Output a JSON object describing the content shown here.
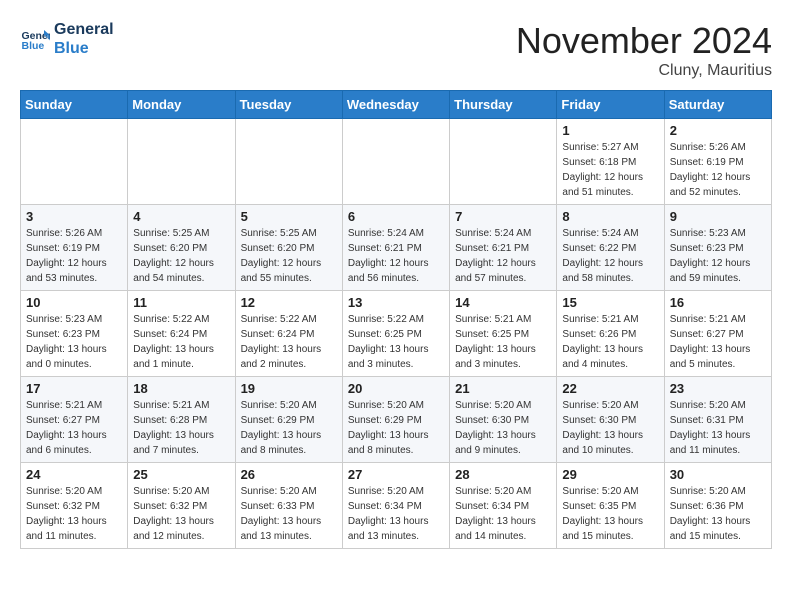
{
  "header": {
    "logo_line1": "General",
    "logo_line2": "Blue",
    "month": "November 2024",
    "location": "Cluny, Mauritius"
  },
  "weekdays": [
    "Sunday",
    "Monday",
    "Tuesday",
    "Wednesday",
    "Thursday",
    "Friday",
    "Saturday"
  ],
  "weeks": [
    [
      {
        "day": "",
        "info": ""
      },
      {
        "day": "",
        "info": ""
      },
      {
        "day": "",
        "info": ""
      },
      {
        "day": "",
        "info": ""
      },
      {
        "day": "",
        "info": ""
      },
      {
        "day": "1",
        "info": "Sunrise: 5:27 AM\nSunset: 6:18 PM\nDaylight: 12 hours and 51 minutes."
      },
      {
        "day": "2",
        "info": "Sunrise: 5:26 AM\nSunset: 6:19 PM\nDaylight: 12 hours and 52 minutes."
      }
    ],
    [
      {
        "day": "3",
        "info": "Sunrise: 5:26 AM\nSunset: 6:19 PM\nDaylight: 12 hours and 53 minutes."
      },
      {
        "day": "4",
        "info": "Sunrise: 5:25 AM\nSunset: 6:20 PM\nDaylight: 12 hours and 54 minutes."
      },
      {
        "day": "5",
        "info": "Sunrise: 5:25 AM\nSunset: 6:20 PM\nDaylight: 12 hours and 55 minutes."
      },
      {
        "day": "6",
        "info": "Sunrise: 5:24 AM\nSunset: 6:21 PM\nDaylight: 12 hours and 56 minutes."
      },
      {
        "day": "7",
        "info": "Sunrise: 5:24 AM\nSunset: 6:21 PM\nDaylight: 12 hours and 57 minutes."
      },
      {
        "day": "8",
        "info": "Sunrise: 5:24 AM\nSunset: 6:22 PM\nDaylight: 12 hours and 58 minutes."
      },
      {
        "day": "9",
        "info": "Sunrise: 5:23 AM\nSunset: 6:23 PM\nDaylight: 12 hours and 59 minutes."
      }
    ],
    [
      {
        "day": "10",
        "info": "Sunrise: 5:23 AM\nSunset: 6:23 PM\nDaylight: 13 hours and 0 minutes."
      },
      {
        "day": "11",
        "info": "Sunrise: 5:22 AM\nSunset: 6:24 PM\nDaylight: 13 hours and 1 minute."
      },
      {
        "day": "12",
        "info": "Sunrise: 5:22 AM\nSunset: 6:24 PM\nDaylight: 13 hours and 2 minutes."
      },
      {
        "day": "13",
        "info": "Sunrise: 5:22 AM\nSunset: 6:25 PM\nDaylight: 13 hours and 3 minutes."
      },
      {
        "day": "14",
        "info": "Sunrise: 5:21 AM\nSunset: 6:25 PM\nDaylight: 13 hours and 3 minutes."
      },
      {
        "day": "15",
        "info": "Sunrise: 5:21 AM\nSunset: 6:26 PM\nDaylight: 13 hours and 4 minutes."
      },
      {
        "day": "16",
        "info": "Sunrise: 5:21 AM\nSunset: 6:27 PM\nDaylight: 13 hours and 5 minutes."
      }
    ],
    [
      {
        "day": "17",
        "info": "Sunrise: 5:21 AM\nSunset: 6:27 PM\nDaylight: 13 hours and 6 minutes."
      },
      {
        "day": "18",
        "info": "Sunrise: 5:21 AM\nSunset: 6:28 PM\nDaylight: 13 hours and 7 minutes."
      },
      {
        "day": "19",
        "info": "Sunrise: 5:20 AM\nSunset: 6:29 PM\nDaylight: 13 hours and 8 minutes."
      },
      {
        "day": "20",
        "info": "Sunrise: 5:20 AM\nSunset: 6:29 PM\nDaylight: 13 hours and 8 minutes."
      },
      {
        "day": "21",
        "info": "Sunrise: 5:20 AM\nSunset: 6:30 PM\nDaylight: 13 hours and 9 minutes."
      },
      {
        "day": "22",
        "info": "Sunrise: 5:20 AM\nSunset: 6:30 PM\nDaylight: 13 hours and 10 minutes."
      },
      {
        "day": "23",
        "info": "Sunrise: 5:20 AM\nSunset: 6:31 PM\nDaylight: 13 hours and 11 minutes."
      }
    ],
    [
      {
        "day": "24",
        "info": "Sunrise: 5:20 AM\nSunset: 6:32 PM\nDaylight: 13 hours and 11 minutes."
      },
      {
        "day": "25",
        "info": "Sunrise: 5:20 AM\nSunset: 6:32 PM\nDaylight: 13 hours and 12 minutes."
      },
      {
        "day": "26",
        "info": "Sunrise: 5:20 AM\nSunset: 6:33 PM\nDaylight: 13 hours and 13 minutes."
      },
      {
        "day": "27",
        "info": "Sunrise: 5:20 AM\nSunset: 6:34 PM\nDaylight: 13 hours and 13 minutes."
      },
      {
        "day": "28",
        "info": "Sunrise: 5:20 AM\nSunset: 6:34 PM\nDaylight: 13 hours and 14 minutes."
      },
      {
        "day": "29",
        "info": "Sunrise: 5:20 AM\nSunset: 6:35 PM\nDaylight: 13 hours and 15 minutes."
      },
      {
        "day": "30",
        "info": "Sunrise: 5:20 AM\nSunset: 6:36 PM\nDaylight: 13 hours and 15 minutes."
      }
    ]
  ]
}
